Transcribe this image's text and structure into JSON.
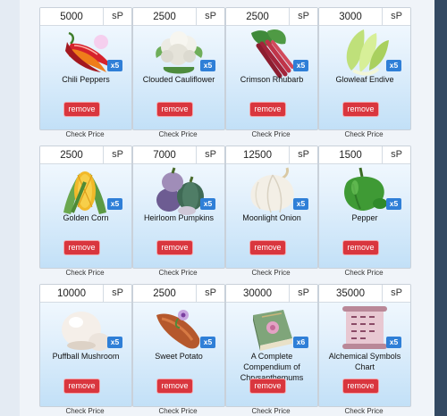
{
  "currency_label": "sP",
  "remove_label": "remove",
  "check_price_label": "Check Price",
  "colors": {
    "remove_button": "#d9363e",
    "qty_badge": "#2f7fd7",
    "card_top": "#f6fbff",
    "card_bottom": "#c2e0f7"
  },
  "items": [
    {
      "price": "5000",
      "qty": "x5",
      "name": "Chili Peppers",
      "icon": "chili-peppers-icon"
    },
    {
      "price": "2500",
      "qty": "x5",
      "name": "Clouded Cauliflower",
      "icon": "cauliflower-icon"
    },
    {
      "price": "2500",
      "qty": "x5",
      "name": "Crimson Rhubarb",
      "icon": "rhubarb-icon"
    },
    {
      "price": "3000",
      "qty": "x5",
      "name": "Glowleaf Endive",
      "icon": "endive-icon"
    },
    {
      "price": "2500",
      "qty": "x5",
      "name": "Golden Corn",
      "icon": "corn-icon"
    },
    {
      "price": "7000",
      "qty": "x5",
      "name": "Heirloom Pumpkins",
      "icon": "pumpkins-icon"
    },
    {
      "price": "12500",
      "qty": "x5",
      "name": "Moonlight Onion",
      "icon": "onion-icon"
    },
    {
      "price": "1500",
      "qty": "x5",
      "name": "Pepper",
      "icon": "green-pepper-icon"
    },
    {
      "price": "10000",
      "qty": "x5",
      "name": "Puffball Mushroom",
      "icon": "mushroom-icon"
    },
    {
      "price": "2500",
      "qty": "x5",
      "name": "Sweet Potato",
      "icon": "sweet-potato-icon"
    },
    {
      "price": "30000",
      "qty": "x6",
      "name": "A Complete Compendium of Chrysanthemums",
      "icon": "book-icon"
    },
    {
      "price": "35000",
      "qty": "x5",
      "name": "Alchemical Symbols Chart",
      "icon": "scroll-chart-icon"
    }
  ]
}
